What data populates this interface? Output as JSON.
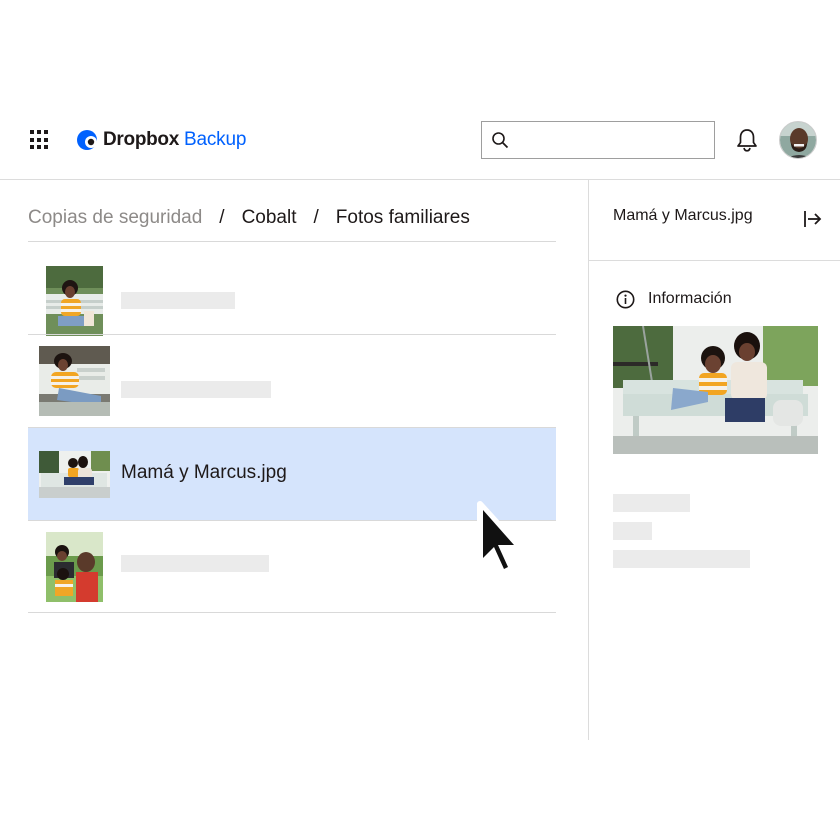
{
  "app": {
    "brand": "Dropbox",
    "product": "Backup",
    "brand_color": "#0061fe"
  },
  "icons": {
    "apps": "apps-grid-icon",
    "logo": "dropbox-logo-icon",
    "search": "search-icon",
    "notifications": "bell-icon",
    "info": "info-icon",
    "close_panel": "close-panel-arrow-icon",
    "pointer": "mouse-pointer-icon"
  },
  "search": {
    "value": "",
    "placeholder": ""
  },
  "breadcrumb": [
    "Copias de seguridad",
    "Cobalt",
    "Fotos familiares"
  ],
  "breadcrumb_separator": "/",
  "files": [
    {
      "name": "",
      "selected": false
    },
    {
      "name": "",
      "selected": false
    },
    {
      "name": "Mamá y Marcus.jpg",
      "selected": true
    },
    {
      "name": "",
      "selected": false
    }
  ],
  "details_panel": {
    "title": "Mamá y Marcus.jpg",
    "section_label": "Información"
  },
  "colors": {
    "selected_row": "#d5e4fc",
    "skeleton": "#ebebeb"
  }
}
